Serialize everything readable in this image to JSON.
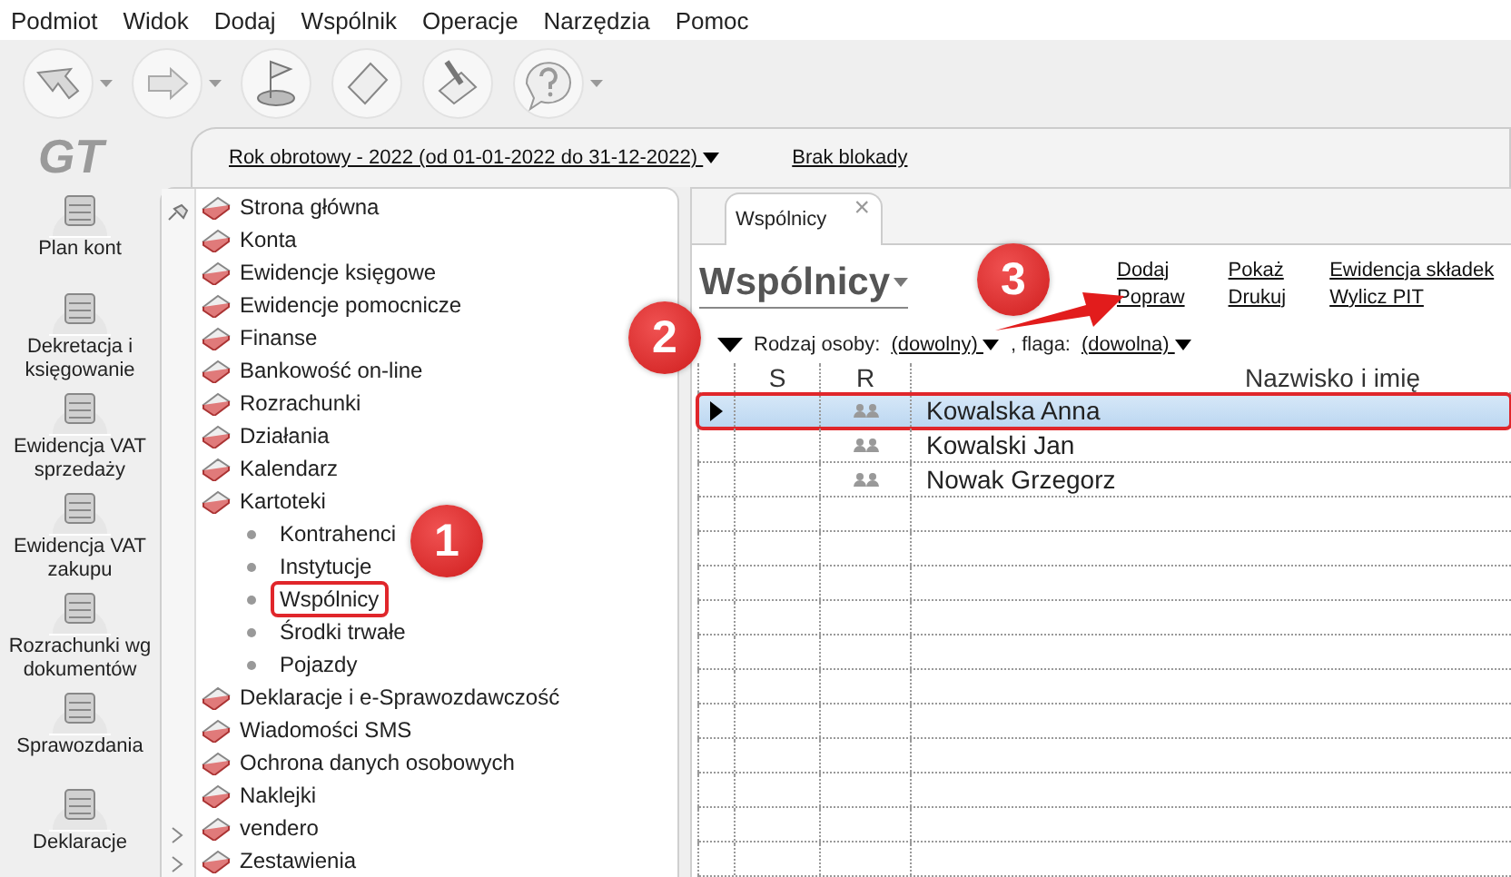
{
  "menu_bar": [
    "Podmiot",
    "Widok",
    "Dodaj",
    "Wspólnik",
    "Operacje",
    "Narzędzia",
    "Pomoc"
  ],
  "toolbar": [
    {
      "kind": "arrow-left",
      "dropdown": true
    },
    {
      "kind": "arrow-right",
      "dropdown": true
    },
    {
      "kind": "flag",
      "dropdown": false
    },
    {
      "kind": "sheet",
      "dropdown": false
    },
    {
      "kind": "brush",
      "dropdown": false
    },
    {
      "kind": "help",
      "dropdown": true
    }
  ],
  "logo": "GT",
  "year_selector": "Rok obrotowy - 2022  (od 01-01-2022 do 31-12-2022)",
  "lock_link": "Brak blokady",
  "left_nav": [
    {
      "label": "Plan kont"
    },
    {
      "label": "Dekretacja i księgowanie"
    },
    {
      "label": "Ewidencja VAT sprzedaży"
    },
    {
      "label": "Ewidencja VAT zakupu"
    },
    {
      "label": "Rozrachunki wg dokumentów"
    },
    {
      "label": "Sprawozdania"
    },
    {
      "label": "Deklaracje"
    }
  ],
  "tree": [
    {
      "label": "Strona główna"
    },
    {
      "label": "Konta"
    },
    {
      "label": "Ewidencje księgowe"
    },
    {
      "label": "Ewidencje pomocnicze"
    },
    {
      "label": "Finanse"
    },
    {
      "label": "Bankowość on-line"
    },
    {
      "label": "Rozrachunki"
    },
    {
      "label": "Działania"
    },
    {
      "label": "Kalendarz"
    },
    {
      "label": "Kartoteki",
      "children": [
        {
          "label": "Kontrahenci",
          "highlighted": false
        },
        {
          "label": "Instytucje",
          "highlighted": false
        },
        {
          "label": "Wspólnicy",
          "highlighted": true
        },
        {
          "label": "Środki trwałe",
          "highlighted": false
        },
        {
          "label": "Pojazdy",
          "highlighted": false
        }
      ]
    },
    {
      "label": "Deklaracje i e-Sprawozdawczość"
    },
    {
      "label": "Wiadomości SMS"
    },
    {
      "label": "Ochrona danych osobowych"
    },
    {
      "label": "Naklejki"
    },
    {
      "label": "vendero"
    },
    {
      "label": "Zestawienia"
    }
  ],
  "tab": {
    "label": "Wspólnicy",
    "close": "×"
  },
  "page_title": "Wspólnicy",
  "actions": [
    [
      "Dodaj",
      "Popraw"
    ],
    [
      "Pokaż",
      "Drukuj"
    ],
    [
      "Ewidencja składek",
      "Wylicz PIT"
    ]
  ],
  "filter": {
    "label": "Rodzaj osoby:",
    "value": "(dowolny)",
    "separator": ", flaga:",
    "flag_value": "(dowolna)"
  },
  "table": {
    "columns": [
      "S",
      "R",
      "Nazwisko i imię"
    ],
    "rows": [
      {
        "name": "Kowalska Anna",
        "selected": true,
        "highlighted": true
      },
      {
        "name": "Kowalski Jan",
        "selected": false,
        "highlighted": false
      },
      {
        "name": "Nowak Grzegorz",
        "selected": false,
        "highlighted": false
      }
    ]
  },
  "annotations": [
    {
      "number": "1"
    },
    {
      "number": "2"
    },
    {
      "number": "3"
    }
  ]
}
